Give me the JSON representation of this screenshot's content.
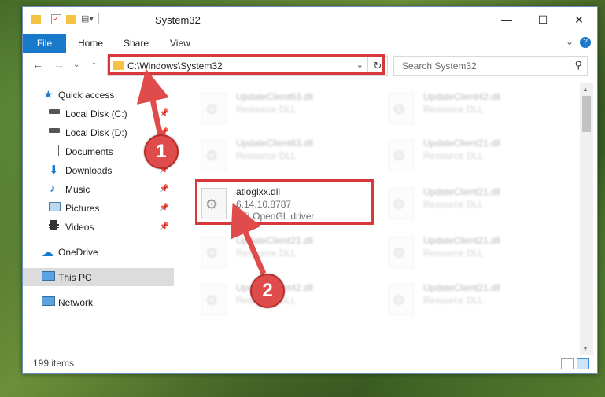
{
  "window": {
    "title": "System32"
  },
  "ribbon": {
    "file": "File",
    "home": "Home",
    "share": "Share",
    "view": "View",
    "help": "?"
  },
  "address": {
    "path": "C:\\Windows\\System32"
  },
  "search": {
    "placeholder": "Search System32"
  },
  "nav": {
    "items": [
      {
        "label": "Quick access",
        "icon": "star-icon"
      },
      {
        "label": "Local Disk (C:)",
        "icon": "drive-icon",
        "pinned": true
      },
      {
        "label": "Local Disk (D:)",
        "icon": "drive-icon",
        "pinned": true
      },
      {
        "label": "Documents",
        "icon": "documents-icon",
        "pinned": true
      },
      {
        "label": "Downloads",
        "icon": "download-icon",
        "pinned": true
      },
      {
        "label": "Music",
        "icon": "music-icon",
        "pinned": true
      },
      {
        "label": "Pictures",
        "icon": "pictures-icon",
        "pinned": true
      },
      {
        "label": "Videos",
        "icon": "videos-icon",
        "pinned": true
      },
      {
        "label": "OneDrive",
        "icon": "cloud-icon"
      },
      {
        "label": "This PC",
        "icon": "computer-icon",
        "selected": true
      },
      {
        "label": "Network",
        "icon": "network-icon"
      }
    ]
  },
  "files": {
    "left": [
      {
        "name": "UpdateClient63.dll",
        "desc": "Resource DLL"
      },
      {
        "name": "UpdateClient63.dll",
        "desc": "Resource DLL"
      },
      {
        "name": "atioglxx.dll",
        "version": "6.14.10.8787",
        "desc": "ATI OpenGL driver"
      },
      {
        "name": "UpdateClient21.dll",
        "desc": "Resource DLL"
      },
      {
        "name": "UpdateClient42.dll",
        "desc": "Resource DLL"
      }
    ],
    "right": [
      {
        "name": "UpdateClient42.dll",
        "desc": "Resource DLL"
      },
      {
        "name": "UpdateClient21.dll",
        "desc": "Resource DLL"
      },
      {
        "name": "UpdateClient21.dll",
        "desc": "Resource DLL"
      },
      {
        "name": "UpdateClient21.dll",
        "desc": "Resource DLL"
      },
      {
        "name": "UpdateClient21.dll",
        "desc": "Resource DLL"
      }
    ]
  },
  "status": {
    "count": "199 items"
  },
  "markers": {
    "first": "1",
    "second": "2"
  },
  "colors": {
    "accent": "#1979ca",
    "highlight": "#d9383a",
    "folder": "#f5c342"
  }
}
